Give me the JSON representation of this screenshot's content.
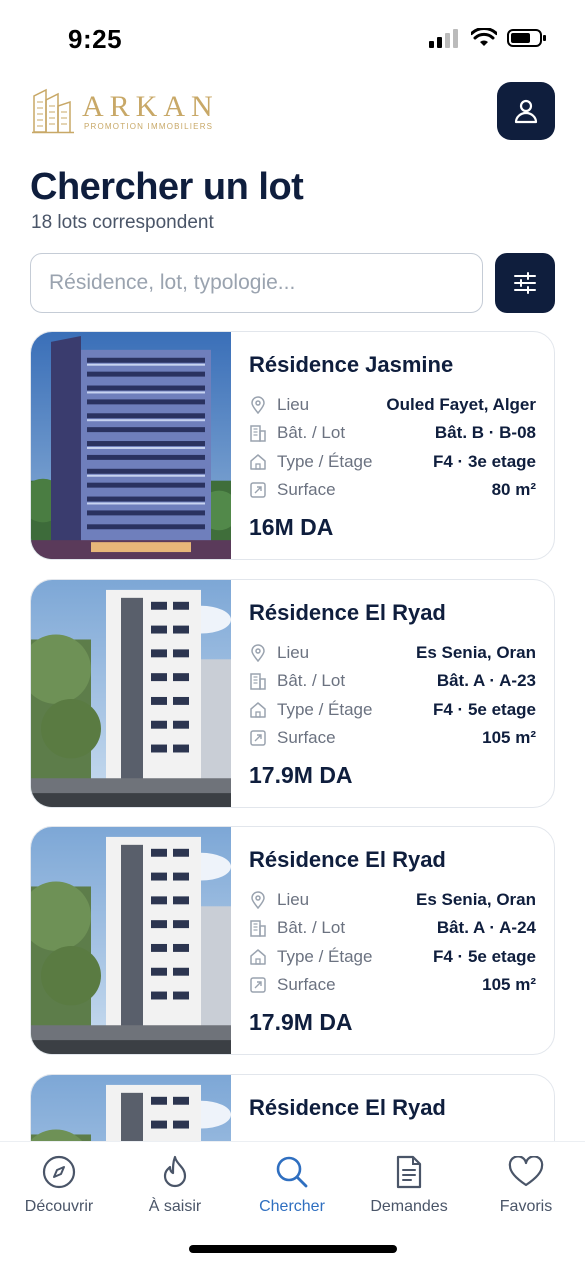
{
  "status_bar": {
    "time": "9:25"
  },
  "header": {
    "logo_text": "ARKAN",
    "logo_subtitle": "PROMOTION IMMOBILIERS",
    "brand_color": "#c8a867",
    "dark_color": "#0f1e3d"
  },
  "page": {
    "title": "Chercher un lot",
    "subtitle": "18 lots correspondent"
  },
  "search": {
    "value": "",
    "placeholder": "Résidence, lot, typologie..."
  },
  "lots": [
    {
      "title": "Résidence Jasmine",
      "lieu_label": "Lieu",
      "lieu": "Ouled Fayet, Alger",
      "lot_label": "Bât. / Lot",
      "lot": "Bât. B · B-08",
      "type_label": "Type / Étage",
      "type": "F4 · 3e etage",
      "surface_label": "Surface",
      "surface": "80 m²",
      "price": "16M DA",
      "image": "tower-blue"
    },
    {
      "title": "Résidence El Ryad",
      "lieu_label": "Lieu",
      "lieu": "Es Senia, Oran",
      "lot_label": "Bât. / Lot",
      "lot": "Bât. A · A-23",
      "type_label": "Type / Étage",
      "type": "F4 · 5e etage",
      "surface_label": "Surface",
      "surface": "105 m²",
      "price": "17.9M DA",
      "image": "tower-white"
    },
    {
      "title": "Résidence El Ryad",
      "lieu_label": "Lieu",
      "lieu": "Es Senia, Oran",
      "lot_label": "Bât. / Lot",
      "lot": "Bât. A · A-24",
      "type_label": "Type / Étage",
      "type": "F4 · 5e etage",
      "surface_label": "Surface",
      "surface": "105 m²",
      "price": "17.9M DA",
      "image": "tower-white"
    },
    {
      "title": "Résidence El Ryad",
      "image": "tower-white"
    }
  ],
  "tab_bar": {
    "active_color": "#2f6fc0",
    "tabs": [
      {
        "label": "Découvrir",
        "icon": "compass-icon"
      },
      {
        "label": "À saisir",
        "icon": "flame-icon"
      },
      {
        "label": "Chercher",
        "icon": "search-icon",
        "active": true
      },
      {
        "label": "Demandes",
        "icon": "document-icon"
      },
      {
        "label": "Favoris",
        "icon": "heart-icon"
      }
    ]
  }
}
